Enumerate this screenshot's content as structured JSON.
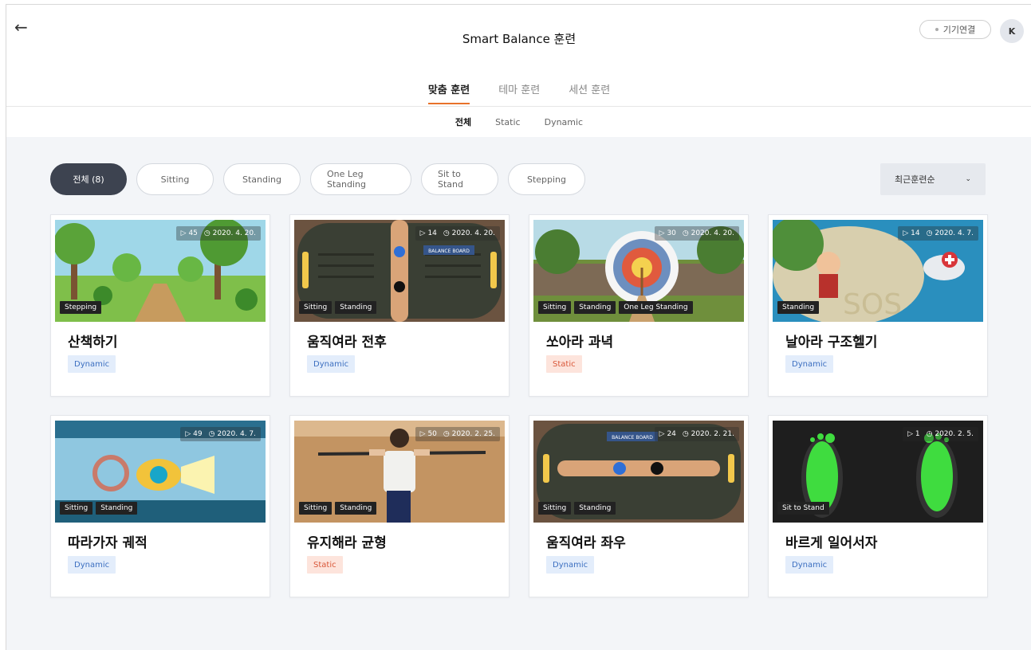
{
  "header": {
    "title": "Smart Balance 훈련",
    "device_label": "기기연결",
    "avatar_initial": "K"
  },
  "tabs": [
    {
      "label": "맞춤 훈련",
      "active": true
    },
    {
      "label": "테마 훈련",
      "active": false
    },
    {
      "label": "세션 훈련",
      "active": false
    }
  ],
  "subtabs": [
    {
      "label": "전체",
      "active": true
    },
    {
      "label": "Static",
      "active": false
    },
    {
      "label": "Dynamic",
      "active": false
    }
  ],
  "filters": [
    {
      "label": "전체 (8)",
      "active": true
    },
    {
      "label": "Sitting",
      "active": false
    },
    {
      "label": "Standing",
      "active": false
    },
    {
      "label": "One Leg Standing",
      "active": false
    },
    {
      "label": "Sit to Stand",
      "active": false
    },
    {
      "label": "Stepping",
      "active": false
    }
  ],
  "sort": {
    "label": "최근훈련순"
  },
  "colors": {
    "accent": "#e8722a",
    "dynamic": "#3c6fc0",
    "static": "#d9583a"
  },
  "cards": [
    {
      "title": "산책하기",
      "plays": "▷ 45",
      "date": "◷ 2020. 4. 20.",
      "tags": [
        "Stepping"
      ],
      "type": "Dynamic",
      "scene": "forest"
    },
    {
      "title": "움직여라 전후",
      "plays": "▷ 14",
      "date": "◷ 2020. 4. 20.",
      "tags": [
        "Sitting",
        "Standing"
      ],
      "type": "Dynamic",
      "scene": "board-vertical",
      "label": "BALANCE BOARD"
    },
    {
      "title": "쏘아라 과녁",
      "plays": "▷ 30",
      "date": "◷ 2020. 4. 20.",
      "tags": [
        "Sitting",
        "Standing",
        "One Leg Standing"
      ],
      "type": "Static",
      "scene": "archery"
    },
    {
      "title": "날아라 구조헬기",
      "plays": "▷ 14",
      "date": "◷ 2020. 4. 7.",
      "tags": [
        "Standing"
      ],
      "type": "Dynamic",
      "scene": "rescue"
    },
    {
      "title": "따라가자 궤적",
      "plays": "▷ 49",
      "date": "◷ 2020. 4. 7.",
      "tags": [
        "Sitting",
        "Standing"
      ],
      "type": "Dynamic",
      "scene": "submarine"
    },
    {
      "title": "유지해라 균형",
      "plays": "▷ 50",
      "date": "◷ 2020. 2. 25.",
      "tags": [
        "Sitting",
        "Standing"
      ],
      "type": "Static",
      "scene": "balance-man"
    },
    {
      "title": "움직여라 좌우",
      "plays": "▷ 24",
      "date": "◷ 2020. 2. 21.",
      "tags": [
        "Sitting",
        "Standing"
      ],
      "type": "Dynamic",
      "scene": "board-horizontal",
      "label": "BALANCE BOARD"
    },
    {
      "title": "바르게 일어서자",
      "plays": "▷ 1",
      "date": "◷ 2020. 2. 5.",
      "tags": [
        "Sit to Stand"
      ],
      "type": "Dynamic",
      "scene": "feet"
    }
  ]
}
